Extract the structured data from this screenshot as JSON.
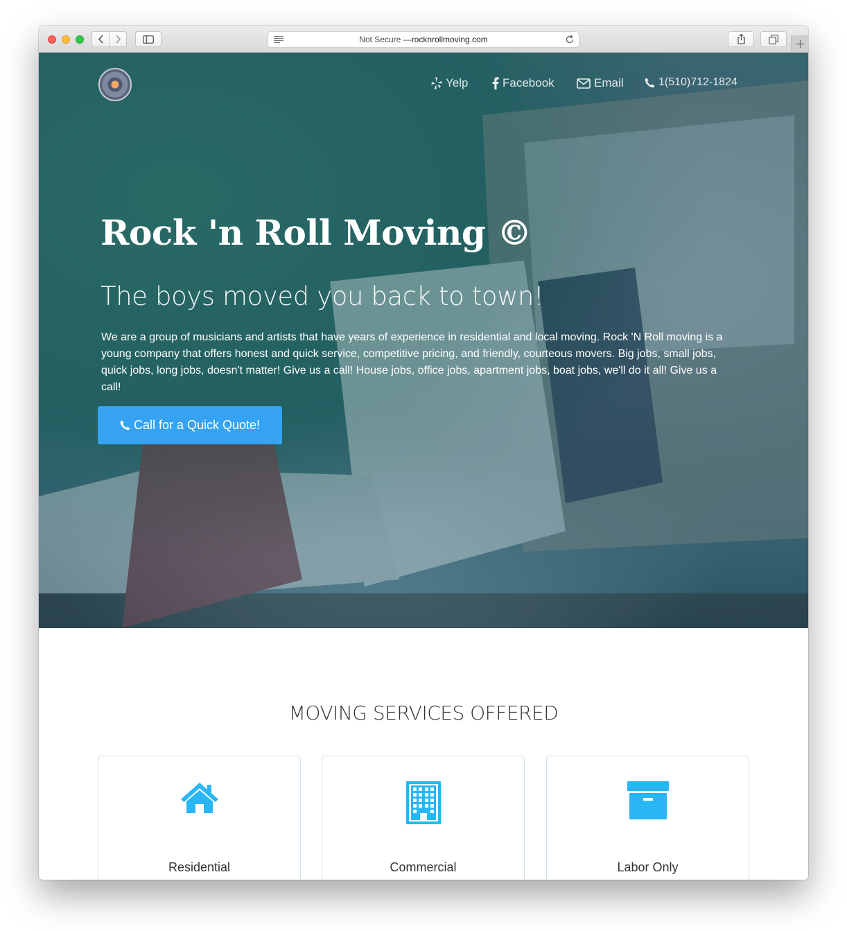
{
  "browser": {
    "address_prefix": "Not Secure — ",
    "address_host": "rocknrollmoving.com"
  },
  "nav": {
    "yelp": "Yelp",
    "facebook": "Facebook",
    "email": "Email",
    "phone": "1(510)712-1824"
  },
  "hero": {
    "title": "Rock 'n Roll Moving ©",
    "subtitle": "The boys moved you back to town!",
    "description": "We are a group of musicians and artists that have years of experience in residential and local moving. Rock 'N Roll moving is a young company that offers honest and quick service, competitive pricing, and friendly, courteous movers. Big jobs, small jobs, quick jobs, long jobs, doesn't matter! Give us a call! House jobs, office jobs, apartment jobs, boat jobs, we'll do it all! Give us a call!",
    "cta": "Call for a Quick Quote!"
  },
  "services": {
    "title": "MOVING SERVICES OFFERED",
    "items": [
      {
        "label": "Residential",
        "icon": "home-icon"
      },
      {
        "label": "Commercial",
        "icon": "building-icon"
      },
      {
        "label": "Labor Only",
        "icon": "archive-box-icon"
      }
    ]
  },
  "colors": {
    "accent": "#35a3f2",
    "icon": "#29b6f6",
    "hero_overlay": "#1c607e"
  }
}
